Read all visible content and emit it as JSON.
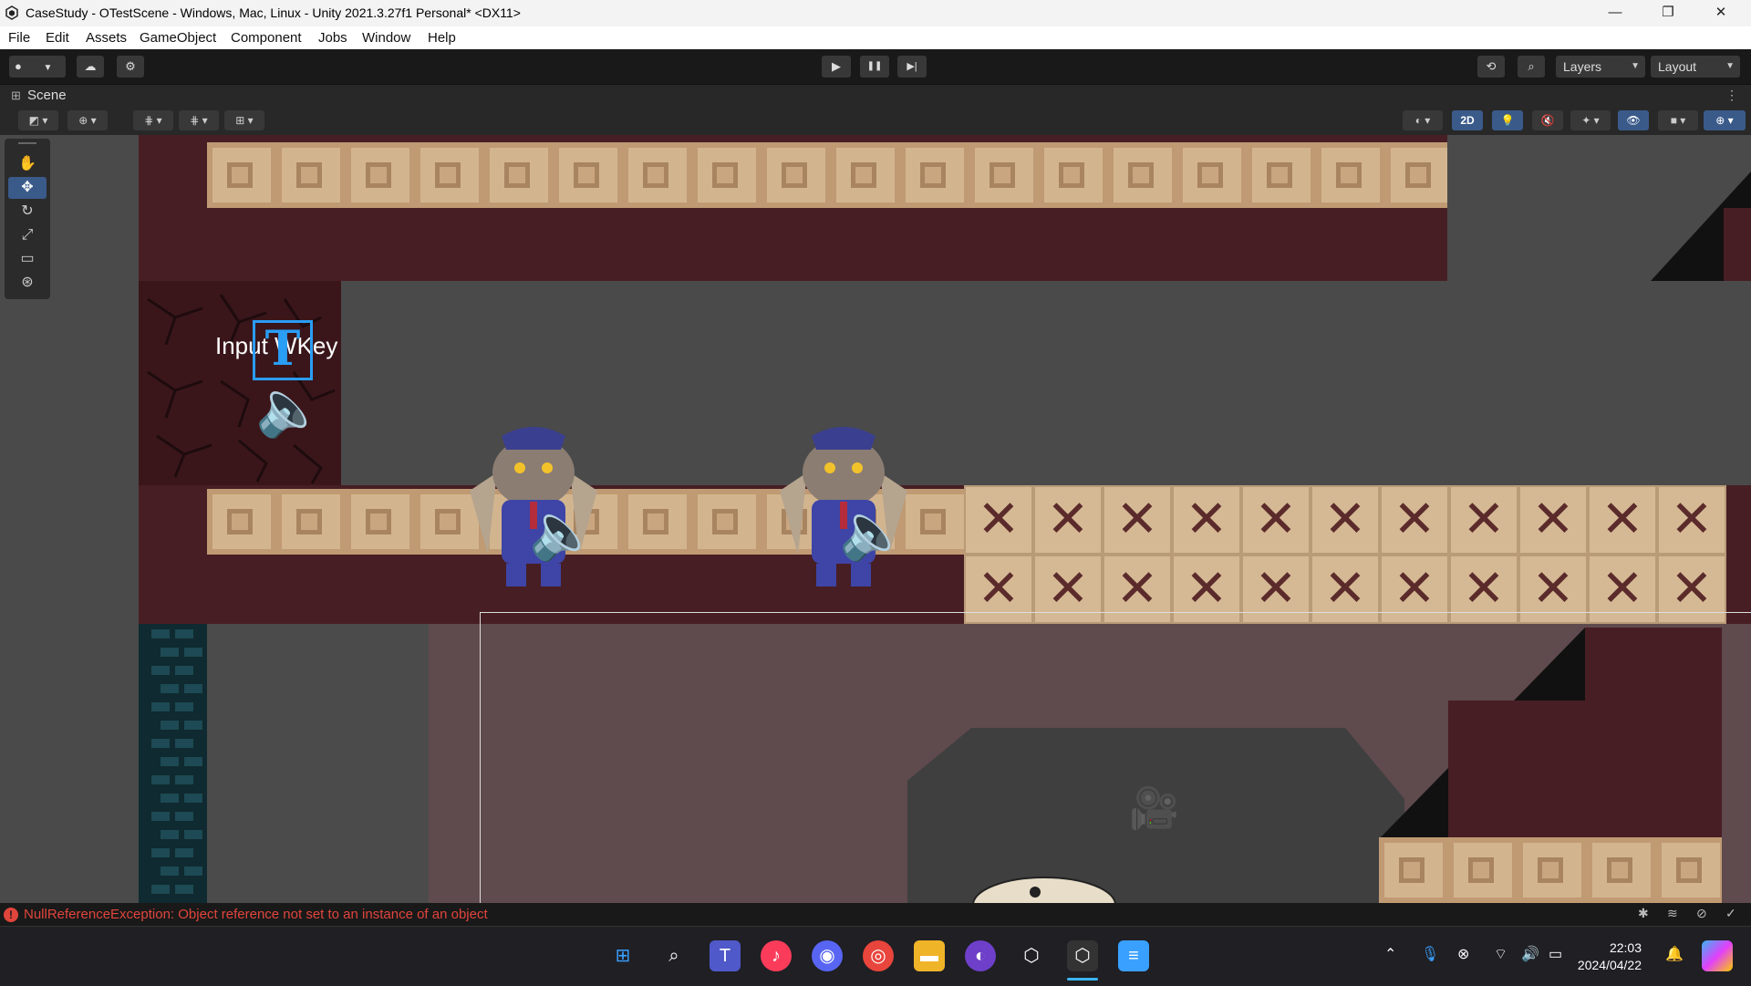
{
  "window": {
    "title": "CaseStudy - OTestScene - Windows, Mac, Linux - Unity 2021.3.27f1 Personal* <DX11>",
    "minimize": "—",
    "maximize": "❐",
    "close": "✕"
  },
  "menu": [
    "File",
    "Edit",
    "Assets",
    "GameObject",
    "Component",
    "Jobs",
    "Window",
    "Help"
  ],
  "toolbar": {
    "play": "▶",
    "pause": "❚❚",
    "step": "▶|",
    "layers_label": "Layers",
    "layout_label": "Layout"
  },
  "scene_tab": {
    "label": "Scene"
  },
  "scene_toolbar": {
    "mode_2d": "2D"
  },
  "scene": {
    "text_object": "Input WKey",
    "text_gizmo": "T"
  },
  "status": {
    "error_message": "NullReferenceException: Object reference not set to an instance of an object"
  },
  "taskbar": {
    "clock_time": "22:03",
    "clock_date": "2024/04/22"
  },
  "colors": {
    "accent": "#3a5a8a",
    "error": "#e0453c",
    "maroon": "#471e24"
  }
}
